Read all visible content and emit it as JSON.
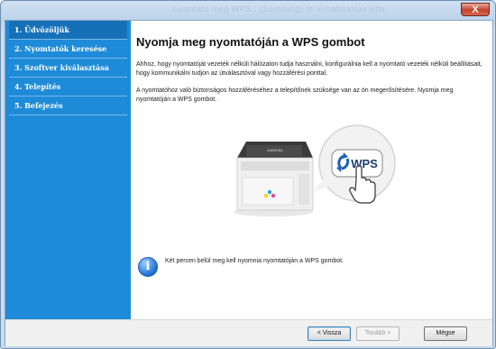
{
  "window": {
    "title_ghost": "nyomtato meg WPS : (Samsung) te xirbahsafsaeleha",
    "close_label": "X"
  },
  "sidebar": {
    "items": [
      {
        "label": "1. Üdvözöljük",
        "active": true
      },
      {
        "label": "2. Nyomtatók keresése",
        "active": false
      },
      {
        "label": "3. Szoftver kiválasztása",
        "active": false
      },
      {
        "label": "4. Telepítés",
        "active": false
      },
      {
        "label": "5. Befejezés",
        "active": false
      }
    ]
  },
  "main": {
    "heading": "Nyomja meg nyomtatóján a WPS gombot",
    "paragraph1": "Ahhoz, hogy nyomtatóját vezeték nélküli hálózaton tudja használni, konfigurálnia kell a nyomtató vezeték nélküli beállításait, hogy kommunikálni tudjon az útválasztóval vagy hozzáférési ponttal.",
    "paragraph2": "A nyomtatóhoz való biztonságos hozzáféréséhez a telepítőnek szüksége van az ön megerősítésére. Nyomja meg nyomtatóján a WPS gombot.",
    "printer_brand": "SAMSUNG",
    "wps_label": "WPS",
    "info_icon": "i",
    "info_text": "Két percen belül meg kell nyomnia nyomtatóján a WPS gombot."
  },
  "footer": {
    "back_label": "< Vissza",
    "next_label": "Tovább >",
    "cancel_label": "Mégse"
  },
  "colors": {
    "sidebar_bg": "#1e8bd8",
    "sidebar_active": "#1570b8",
    "wps_blue": "#1f5fb8"
  }
}
